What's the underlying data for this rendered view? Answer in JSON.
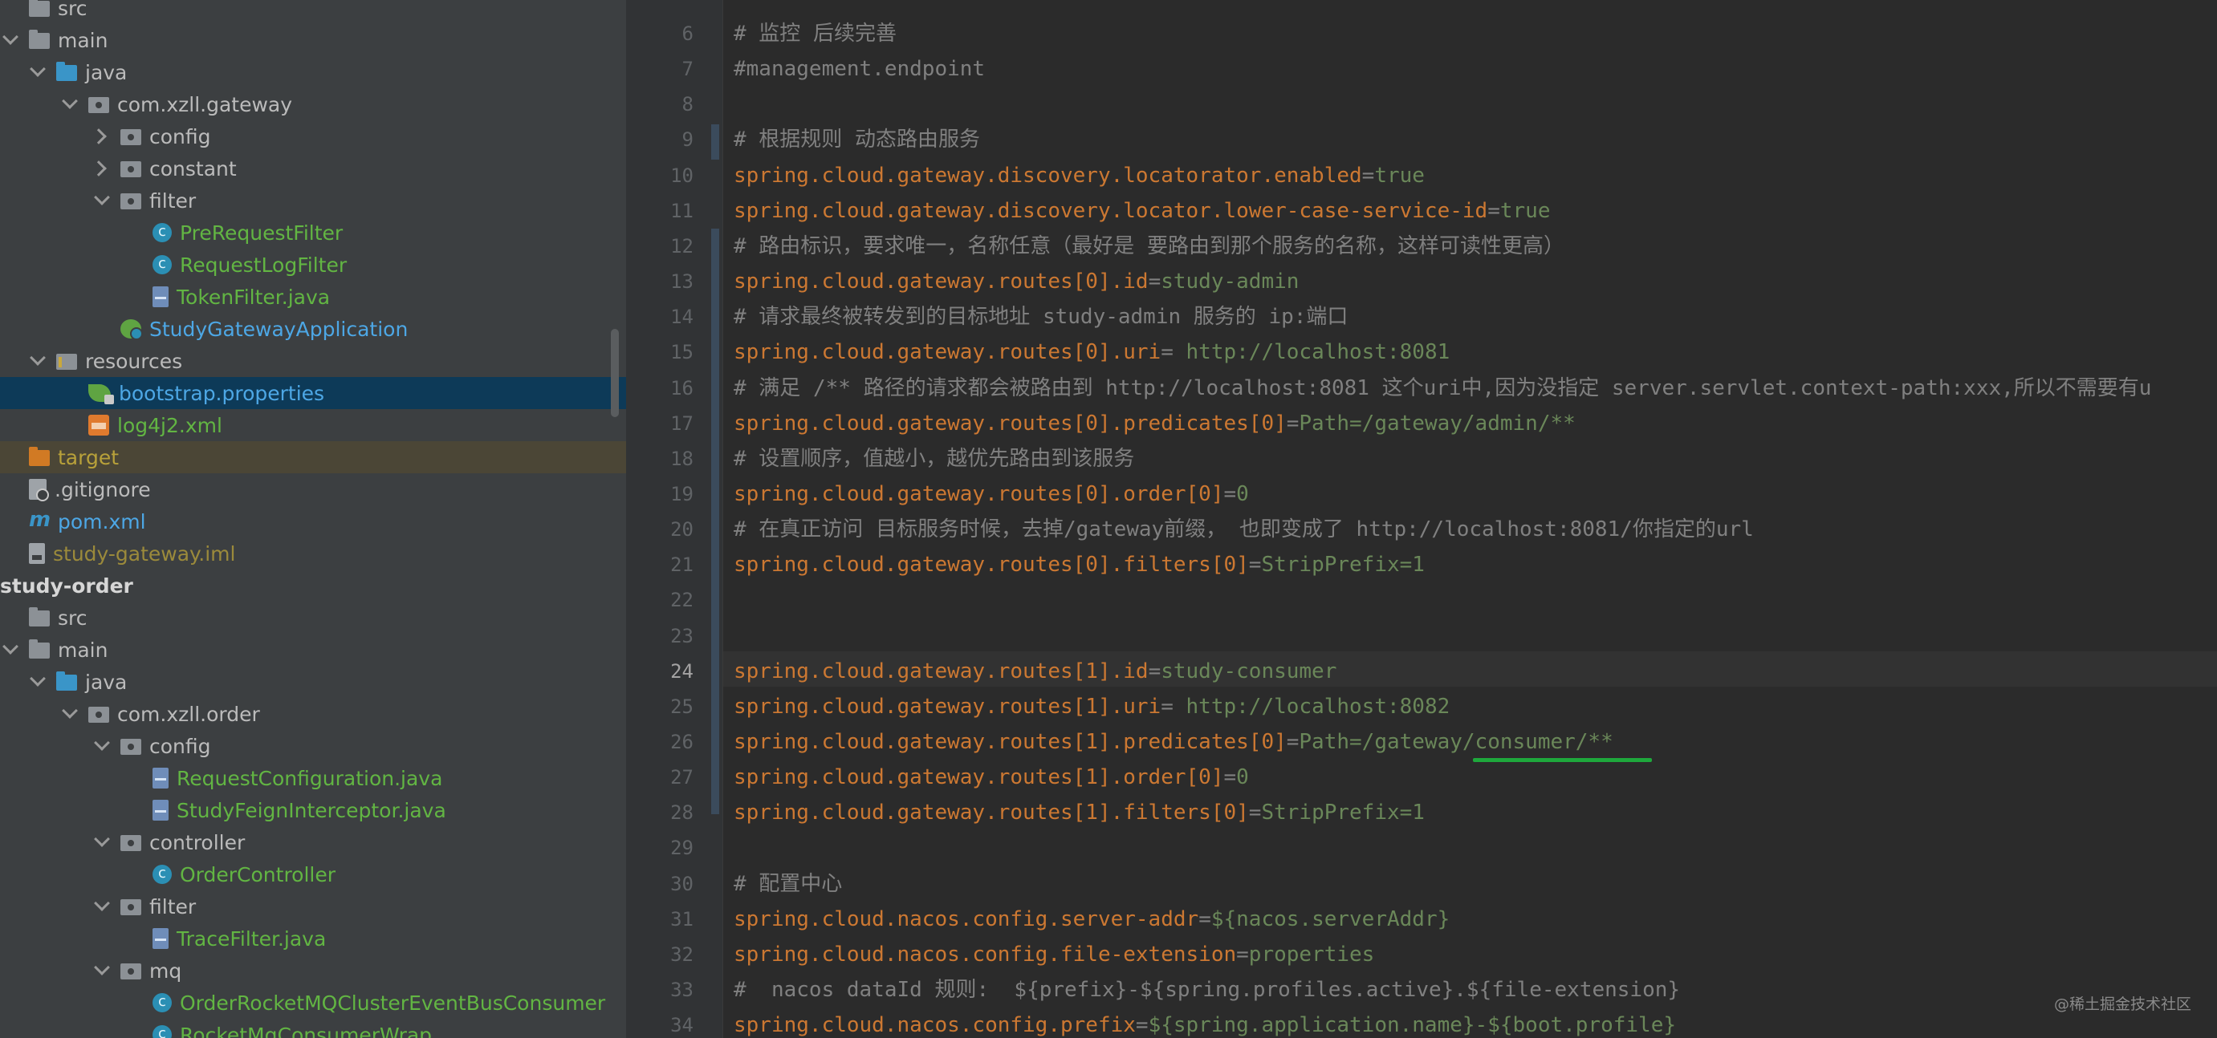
{
  "project_tree": {
    "items": [
      {
        "label": "src",
        "indent": 0,
        "arrow": "none",
        "icon": "folder",
        "color": "default"
      },
      {
        "label": "main",
        "indent": 0,
        "arrow": "down",
        "icon": "folder",
        "color": "default"
      },
      {
        "label": "java",
        "indent": 1,
        "arrow": "down",
        "icon": "folder-src",
        "color": "default"
      },
      {
        "label": "com.xzll.gateway",
        "indent": 2,
        "arrow": "down",
        "icon": "package",
        "color": "default"
      },
      {
        "label": "config",
        "indent": 3,
        "arrow": "right",
        "icon": "package",
        "color": "default"
      },
      {
        "label": "constant",
        "indent": 3,
        "arrow": "right",
        "icon": "package",
        "color": "default"
      },
      {
        "label": "filter",
        "indent": 3,
        "arrow": "down",
        "icon": "package",
        "color": "default"
      },
      {
        "label": "PreRequestFilter",
        "indent": 4,
        "arrow": "none",
        "icon": "class",
        "color": "green"
      },
      {
        "label": "RequestLogFilter",
        "indent": 4,
        "arrow": "none",
        "icon": "class",
        "color": "green"
      },
      {
        "label": "TokenFilter.java",
        "indent": 4,
        "arrow": "none",
        "icon": "java-file",
        "color": "green"
      },
      {
        "label": "StudyGatewayApplication",
        "indent": 3,
        "arrow": "none",
        "icon": "spring",
        "color": "blue"
      },
      {
        "label": "resources",
        "indent": 1,
        "arrow": "down",
        "icon": "resources",
        "color": "default"
      },
      {
        "label": "bootstrap.properties",
        "indent": 2,
        "arrow": "none",
        "icon": "leaf",
        "color": "blue",
        "selected": true
      },
      {
        "label": "log4j2.xml",
        "indent": 2,
        "arrow": "none",
        "icon": "xml",
        "color": "green"
      },
      {
        "label": "target",
        "indent": 0,
        "arrow": "none",
        "icon": "folder-orange",
        "color": "yellow",
        "excluded": true
      },
      {
        "label": ".gitignore",
        "indent": 0,
        "arrow": "none",
        "icon": "git",
        "color": "default"
      },
      {
        "label": "pom.xml",
        "indent": 0,
        "arrow": "none",
        "icon": "maven",
        "color": "blue"
      },
      {
        "label": "study-gateway.iml",
        "indent": 0,
        "arrow": "none",
        "icon": "iml",
        "color": "olive"
      },
      {
        "label": "study-order",
        "indent": -1,
        "arrow": "none",
        "icon": "none",
        "color": "bold"
      },
      {
        "label": "src",
        "indent": 0,
        "arrow": "none",
        "icon": "folder",
        "color": "default"
      },
      {
        "label": "main",
        "indent": 0,
        "arrow": "down",
        "icon": "folder",
        "color": "default"
      },
      {
        "label": "java",
        "indent": 1,
        "arrow": "down",
        "icon": "folder-src",
        "color": "default"
      },
      {
        "label": "com.xzll.order",
        "indent": 2,
        "arrow": "down",
        "icon": "package",
        "color": "default"
      },
      {
        "label": "config",
        "indent": 3,
        "arrow": "down",
        "icon": "package",
        "color": "default"
      },
      {
        "label": "RequestConfiguration.java",
        "indent": 4,
        "arrow": "none",
        "icon": "java-file",
        "color": "green"
      },
      {
        "label": "StudyFeignInterceptor.java",
        "indent": 4,
        "arrow": "none",
        "icon": "java-file",
        "color": "green"
      },
      {
        "label": "controller",
        "indent": 3,
        "arrow": "down",
        "icon": "package",
        "color": "default"
      },
      {
        "label": "OrderController",
        "indent": 4,
        "arrow": "none",
        "icon": "class",
        "color": "green"
      },
      {
        "label": "filter",
        "indent": 3,
        "arrow": "down",
        "icon": "package",
        "color": "default"
      },
      {
        "label": "TraceFilter.java",
        "indent": 4,
        "arrow": "none",
        "icon": "java-file",
        "color": "green"
      },
      {
        "label": "mq",
        "indent": 3,
        "arrow": "down",
        "icon": "package",
        "color": "default"
      },
      {
        "label": "OrderRocketMQClusterEventBusConsumer",
        "indent": 4,
        "arrow": "none",
        "icon": "class",
        "color": "green"
      },
      {
        "label": "RocketMqConsumerWrap",
        "indent": 4,
        "arrow": "none",
        "icon": "class",
        "color": "green"
      }
    ]
  },
  "editor": {
    "current_line": "24",
    "lines": [
      {
        "num": "6",
        "parts": [
          {
            "t": "# 监控 后续完善",
            "c": "comment"
          }
        ]
      },
      {
        "num": "7",
        "parts": [
          {
            "t": "#management.endpoint",
            "c": "comment"
          }
        ]
      },
      {
        "num": "8",
        "parts": []
      },
      {
        "num": "9",
        "parts": [
          {
            "t": "# 根据规则 动态路由服务",
            "c": "comment"
          }
        ]
      },
      {
        "num": "10",
        "parts": [
          {
            "t": "spring.cloud.gateway.discovery.locatorator.enabled",
            "c": "key"
          },
          {
            "t": "=",
            "c": "eq"
          },
          {
            "t": "true",
            "c": "val"
          }
        ]
      },
      {
        "num": "11",
        "parts": [
          {
            "t": "spring.cloud.gateway.discovery.locator.lower-case-service-id",
            "c": "key"
          },
          {
            "t": "=",
            "c": "eq"
          },
          {
            "t": "true",
            "c": "val"
          }
        ]
      },
      {
        "num": "12",
        "parts": [
          {
            "t": "# 路由标识，要求唯一，名称任意（最好是 要路由到那个服务的名称，这样可读性更高）",
            "c": "comment"
          }
        ]
      },
      {
        "num": "13",
        "parts": [
          {
            "t": "spring.cloud.gateway.routes[0].id",
            "c": "key"
          },
          {
            "t": "=",
            "c": "eq"
          },
          {
            "t": "study-admin",
            "c": "val"
          }
        ]
      },
      {
        "num": "14",
        "parts": [
          {
            "t": "# 请求最终被转发到的目标地址 study-admin 服务的 ip:端口",
            "c": "comment"
          }
        ]
      },
      {
        "num": "15",
        "parts": [
          {
            "t": "spring.cloud.gateway.routes[0].uri",
            "c": "key"
          },
          {
            "t": "= ",
            "c": "eq"
          },
          {
            "t": "http://localhost:8081",
            "c": "val"
          }
        ]
      },
      {
        "num": "16",
        "parts": [
          {
            "t": "# 满足 /** 路径的请求都会被路由到 http://localhost:8081 这个uri中,因为没指定 server.servlet.context-path:xxx,所以不需要有u",
            "c": "comment"
          }
        ]
      },
      {
        "num": "17",
        "parts": [
          {
            "t": "spring.cloud.gateway.routes[0].predicates[0]",
            "c": "key"
          },
          {
            "t": "=",
            "c": "eq"
          },
          {
            "t": "Path=/gateway/admin/**",
            "c": "val"
          }
        ]
      },
      {
        "num": "18",
        "parts": [
          {
            "t": "# 设置顺序，值越小，越优先路由到该服务",
            "c": "comment"
          }
        ]
      },
      {
        "num": "19",
        "parts": [
          {
            "t": "spring.cloud.gateway.routes[0].order[0]",
            "c": "key"
          },
          {
            "t": "=",
            "c": "eq"
          },
          {
            "t": "0",
            "c": "val"
          }
        ]
      },
      {
        "num": "20",
        "parts": [
          {
            "t": "# 在真正访问 目标服务时候，去掉/gateway前缀， 也即变成了 http://localhost:8081/你指定的url",
            "c": "comment"
          }
        ]
      },
      {
        "num": "21",
        "parts": [
          {
            "t": "spring.cloud.gateway.routes[0].filters[0]",
            "c": "key"
          },
          {
            "t": "=",
            "c": "eq"
          },
          {
            "t": "StripPrefix=1",
            "c": "val"
          }
        ]
      },
      {
        "num": "22",
        "parts": []
      },
      {
        "num": "23",
        "parts": []
      },
      {
        "num": "24",
        "parts": [
          {
            "t": "spring.cloud.gateway.routes[1].id",
            "c": "key"
          },
          {
            "t": "=",
            "c": "eq"
          },
          {
            "t": "study-consumer",
            "c": "val"
          }
        ]
      },
      {
        "num": "25",
        "parts": [
          {
            "t": "spring.cloud.gateway.routes[1].uri",
            "c": "key"
          },
          {
            "t": "= ",
            "c": "eq"
          },
          {
            "t": "http://localhost:8082",
            "c": "val"
          }
        ]
      },
      {
        "num": "26",
        "parts": [
          {
            "t": "spring.cloud.gateway.routes[1].predicates[0]",
            "c": "key"
          },
          {
            "t": "=",
            "c": "eq"
          },
          {
            "t": "Path=/gateway/consumer/**",
            "c": "val"
          }
        ]
      },
      {
        "num": "27",
        "parts": [
          {
            "t": "spring.cloud.gateway.routes[1].order[0]",
            "c": "key"
          },
          {
            "t": "=",
            "c": "eq"
          },
          {
            "t": "0",
            "c": "val"
          }
        ]
      },
      {
        "num": "28",
        "parts": [
          {
            "t": "spring.cloud.gateway.routes[1].filters[0]",
            "c": "key"
          },
          {
            "t": "=",
            "c": "eq"
          },
          {
            "t": "StripPrefix=1",
            "c": "val"
          }
        ]
      },
      {
        "num": "29",
        "parts": []
      },
      {
        "num": "30",
        "parts": [
          {
            "t": "# 配置中心",
            "c": "comment"
          }
        ]
      },
      {
        "num": "31",
        "parts": [
          {
            "t": "spring.cloud.nacos.config.server-addr",
            "c": "key"
          },
          {
            "t": "=",
            "c": "eq"
          },
          {
            "t": "${nacos.serverAddr}",
            "c": "val"
          }
        ]
      },
      {
        "num": "32",
        "parts": [
          {
            "t": "spring.cloud.nacos.config.file-extension",
            "c": "key"
          },
          {
            "t": "=",
            "c": "eq"
          },
          {
            "t": "properties",
            "c": "val"
          }
        ]
      },
      {
        "num": "33",
        "parts": [
          {
            "t": "#  nacos dataId 规则:  ${prefix}-${spring.profiles.active}.${file-extension}",
            "c": "comment"
          }
        ]
      },
      {
        "num": "34",
        "parts": [
          {
            "t": "spring.cloud.nacos.config.prefix",
            "c": "key"
          },
          {
            "t": "=",
            "c": "eq"
          },
          {
            "t": "${spring.application.name}-${boot.profile}",
            "c": "val"
          }
        ]
      }
    ]
  },
  "watermark": "@稀土掘金技术社区",
  "colors": {
    "tree_bg": "#3c3f41",
    "editor_bg": "#2b2b2b",
    "selection": "#0d3a58",
    "key": "#cc7832",
    "value": "#6a8759",
    "comment": "#808080",
    "underline": "#1ea83c"
  }
}
